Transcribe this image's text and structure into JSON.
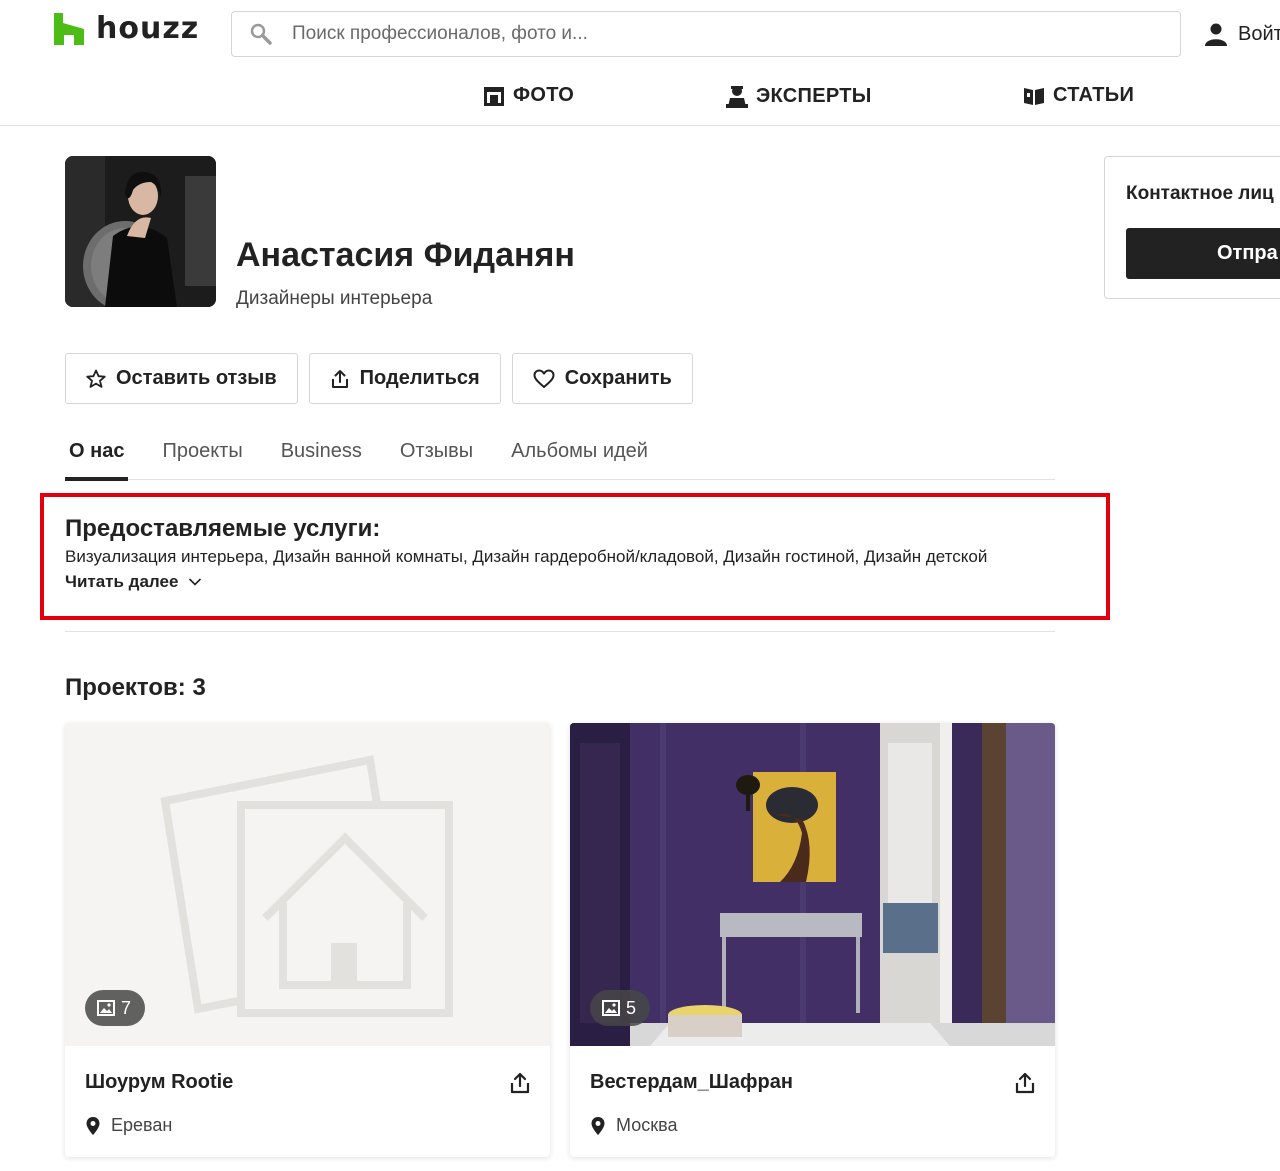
{
  "header": {
    "logo_text": "houzz",
    "search_placeholder": "Поиск профессионалов, фото и...",
    "login_label": "Войт"
  },
  "nav": {
    "items": [
      {
        "label": "ФОТО",
        "icon": "photo-icon"
      },
      {
        "label": "ЭКСПЕРТЫ",
        "icon": "expert-icon"
      },
      {
        "label": "СТАТЬИ",
        "icon": "book-icon"
      }
    ]
  },
  "profile": {
    "name": "Анастасия Фиданян",
    "category": "Дизайнеры интерьера"
  },
  "actions": {
    "review_label": "Оставить отзыв",
    "share_label": "Поделиться",
    "save_label": "Сохранить"
  },
  "tabs": [
    {
      "label": "О нас",
      "active": true
    },
    {
      "label": "Проекты",
      "active": false
    },
    {
      "label": "Business",
      "active": false
    },
    {
      "label": "Отзывы",
      "active": false
    },
    {
      "label": "Альбомы идей",
      "active": false
    }
  ],
  "services": {
    "title": "Предоставляемые услуги:",
    "text": "Визуализация интерьера, Дизайн ванной комнаты, Дизайн гардеробной/кладовой, Дизайн гостиной, Дизайн детской",
    "read_more": "Читать далее"
  },
  "projects": {
    "title": "Проектов: 3",
    "cards": [
      {
        "title": "Шоурум Rootie",
        "location": "Ереван",
        "photo_count": "7"
      },
      {
        "title": "Вестердам_Шафран",
        "location": "Москва",
        "photo_count": "5"
      }
    ]
  },
  "contact": {
    "title": "Контактное лиц",
    "button_label": "Отпра"
  },
  "colors": {
    "brand_green": "#4dbc15",
    "highlight_red": "#e2000f",
    "dark": "#222222",
    "purple_wall": "#3b2a5c"
  }
}
